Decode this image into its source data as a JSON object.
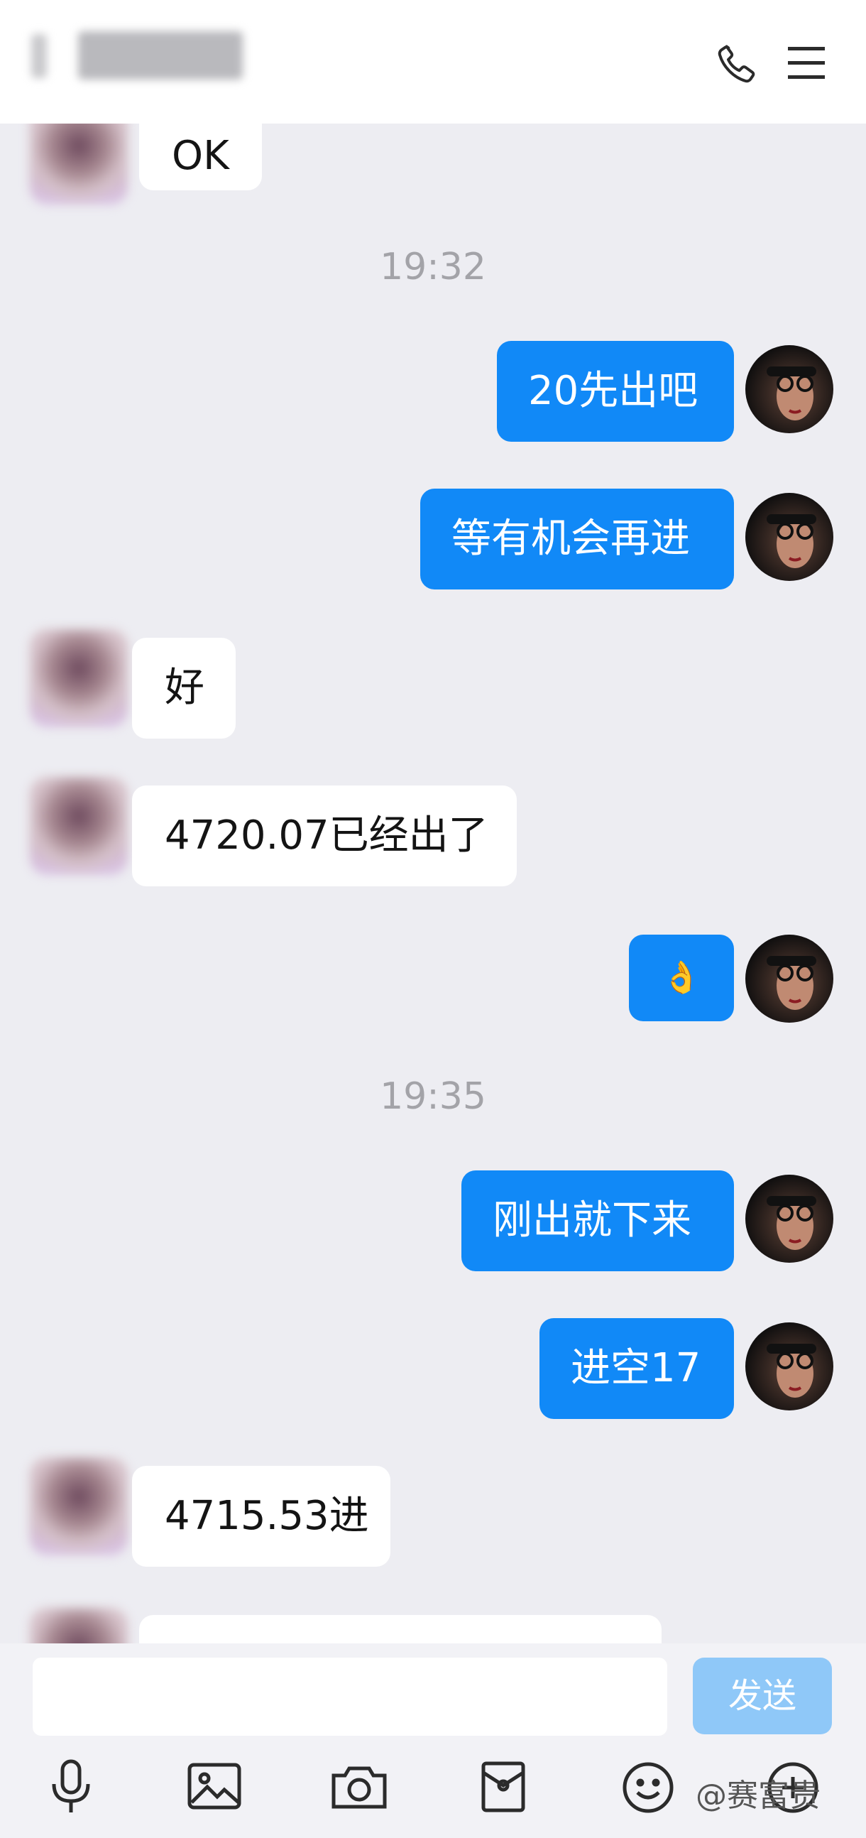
{
  "header": {
    "contact_name": "",
    "call_icon": "phone-icon",
    "menu_icon": "hamburger-menu-icon"
  },
  "messages": [
    {
      "side": "in",
      "text": "OK"
    },
    {
      "timestamp": "19:32"
    },
    {
      "side": "out",
      "text": "20先出吧"
    },
    {
      "side": "out",
      "text": "等有机会再进"
    },
    {
      "side": "in",
      "text": "好"
    },
    {
      "side": "in",
      "text": "4720.07已经出了"
    },
    {
      "side": "out",
      "text": "👌"
    },
    {
      "timestamp": "19:35"
    },
    {
      "side": "out",
      "text": "刚出就下来"
    },
    {
      "side": "out",
      "text": "进空17"
    },
    {
      "side": "in",
      "text": "4715.53进"
    }
  ],
  "composer": {
    "input_value": "",
    "send_label": "发送"
  },
  "toolbar": {
    "icons": [
      "microphone-icon",
      "image-icon",
      "camera-icon",
      "red-envelope-icon",
      "emoji-icon",
      "more-icon"
    ]
  },
  "watermark": "@赛富贵",
  "colors": {
    "outgoing_bubble": "#1189F7",
    "incoming_bubble": "#FFFFFF",
    "chat_background": "#EDEDF2",
    "send_button_disabled": "#8FC8F8"
  }
}
